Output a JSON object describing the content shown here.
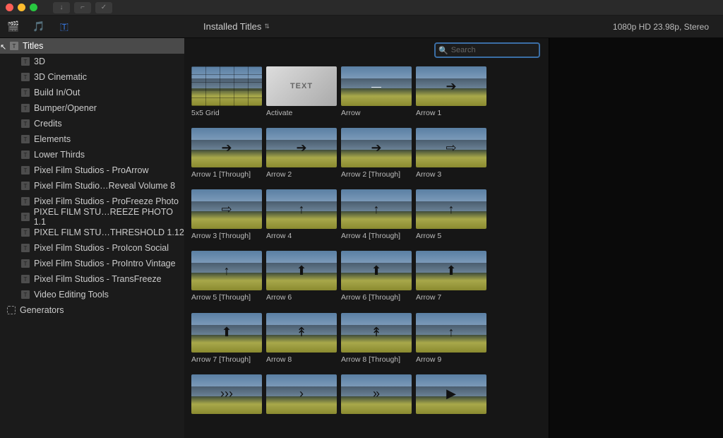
{
  "titlebar": {
    "buttons": [
      "↓",
      "⌐",
      "✓"
    ]
  },
  "toolbar": {
    "heading": "Installed Titles",
    "meta": "1080p HD 23.98p, Stereo"
  },
  "search": {
    "placeholder": "Search"
  },
  "sidebar": {
    "root": "Titles",
    "children": [
      "3D",
      "3D Cinematic",
      "Build In/Out",
      "Bumper/Opener",
      "Credits",
      "Elements",
      "Lower Thirds",
      "Pixel Film Studios - ProArrow",
      "Pixel Film Studio…Reveal Volume 8",
      "Pixel Film Studios - ProFreeze Photo",
      "PIXEL FILM STU…REEZE PHOTO 1.1",
      "PIXEL FILM STU…THRESHOLD 1.12",
      "Pixel Film Studios - ProIcon Social",
      "Pixel Film Studios - ProIntro Vintage",
      "Pixel Film Studios - TransFreeze",
      "Video Editing Tools"
    ],
    "generators": "Generators"
  },
  "grid": [
    {
      "label": "5x5 Grid",
      "variant": "grid",
      "glyph": ""
    },
    {
      "label": "Activate",
      "variant": "activate",
      "glyph": "TEXT"
    },
    {
      "label": "Arrow",
      "variant": "land",
      "glyph": "—",
      "thin": true
    },
    {
      "label": "Arrow 1",
      "variant": "land",
      "glyph": "➔"
    },
    {
      "label": "Arrow 1 [Through]",
      "variant": "land",
      "glyph": "➔"
    },
    {
      "label": "Arrow 2",
      "variant": "land",
      "glyph": "➔"
    },
    {
      "label": "Arrow 2 [Through]",
      "variant": "land",
      "glyph": "➔"
    },
    {
      "label": "Arrow 3",
      "variant": "land",
      "glyph": "⇨"
    },
    {
      "label": "Arrow 3 [Through]",
      "variant": "land",
      "glyph": "⇨"
    },
    {
      "label": "Arrow 4",
      "variant": "land",
      "glyph": "↑"
    },
    {
      "label": "Arrow 4 [Through]",
      "variant": "land",
      "glyph": "↑"
    },
    {
      "label": "Arrow 5",
      "variant": "land",
      "glyph": "↑"
    },
    {
      "label": "Arrow 5 [Through]",
      "variant": "land",
      "glyph": "↑"
    },
    {
      "label": "Arrow 6",
      "variant": "land",
      "glyph": "⬆"
    },
    {
      "label": "Arrow 6 [Through]",
      "variant": "land",
      "glyph": "⬆"
    },
    {
      "label": "Arrow 7",
      "variant": "land",
      "glyph": "⬆"
    },
    {
      "label": "Arrow 7 [Through]",
      "variant": "land",
      "glyph": "⬆"
    },
    {
      "label": "Arrow 8",
      "variant": "land",
      "glyph": "↟"
    },
    {
      "label": "Arrow 8 [Through]",
      "variant": "land",
      "glyph": "↟"
    },
    {
      "label": "Arrow 9",
      "variant": "land",
      "glyph": "↑"
    },
    {
      "label": "",
      "variant": "land",
      "glyph": "›››"
    },
    {
      "label": "",
      "variant": "land",
      "glyph": "›"
    },
    {
      "label": "",
      "variant": "land",
      "glyph": "»"
    },
    {
      "label": "",
      "variant": "land",
      "glyph": "▶"
    }
  ]
}
